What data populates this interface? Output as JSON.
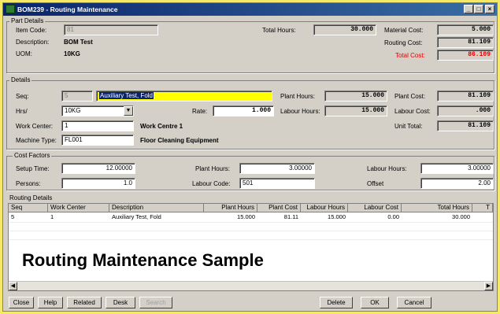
{
  "window": {
    "title": "BOM239 - Routing Maintenance"
  },
  "part_details": {
    "group_label": "Part Details",
    "item_code_label": "Item Code:",
    "item_code": "81",
    "description_label": "Description:",
    "description": "BOM Test",
    "uom_label": "UOM:",
    "uom": "10KG",
    "total_hours_label": "Total Hours:",
    "total_hours": "30.000",
    "material_cost_label": "Material Cost:",
    "material_cost": "5.000",
    "routing_cost_label": "Routing Cost:",
    "routing_cost": "81.109",
    "total_cost_label": "Total Cost:",
    "total_cost": "86.109"
  },
  "details": {
    "group_label": "Details",
    "seq_label": "Seq:",
    "seq": "5",
    "description": "Auxiliary Test, Fold",
    "hrs_label": "Hrs/",
    "hrs_select": "10KG",
    "rate_label": "Rate:",
    "rate": "1.000",
    "plant_hours_label": "Plant Hours:",
    "plant_hours": "15.000",
    "labour_hours_label": "Labour Hours:",
    "labour_hours": "15.000",
    "plant_cost_label": "Plant Cost:",
    "plant_cost": "81.109",
    "labour_cost_label": "Labour Cost:",
    "labour_cost": ".000",
    "unit_total_label": "Unit Total:",
    "unit_total": "81.109",
    "work_center_label": "Work Center:",
    "work_center": "1",
    "work_center_name": "Work Centre 1",
    "machine_type_label": "Machine Type:",
    "machine_type": "FL001",
    "machine_type_name": "Floor Cleaning Equipment"
  },
  "cost_factors": {
    "group_label": "Cost Factors",
    "setup_time_label": "Setup Time:",
    "setup_time": "12.00000",
    "persons_label": "Persons:",
    "persons": "1.0",
    "plant_hours_label": "Plant Hours:",
    "plant_hours": "3.00000",
    "labour_code_label": "Labour Code:",
    "labour_code": "501",
    "labour_hours_label": "Labour Hours:",
    "labour_hours": "3.00000",
    "offset_label": "Offset",
    "offset": "2.00"
  },
  "routing_details": {
    "group_label": "Routing Details",
    "columns": [
      "Seq",
      "Work Center",
      "Description",
      "Plant Hours",
      "Plant Cost",
      "Labour Hours",
      "Labour Cost",
      "Total Hours",
      "T"
    ],
    "rows": [
      [
        "5",
        "1",
        "Auxiliary Test, Fold",
        "15.000",
        "81.11",
        "15.000",
        "0.00",
        "30.000",
        ""
      ]
    ]
  },
  "overlay_caption": "Routing Maintenance Sample",
  "buttons": {
    "close": "Close",
    "help": "Help",
    "related": "Related",
    "desk": "Desk",
    "search": "Search",
    "delete": "Delete",
    "ok": "OK",
    "cancel": "Cancel"
  },
  "colors": {
    "title_start": "#0a246a",
    "title_end": "#3a6ea5",
    "highlight": "#ffff00",
    "total_cost": "#e00000",
    "background": "#f6e96a"
  }
}
